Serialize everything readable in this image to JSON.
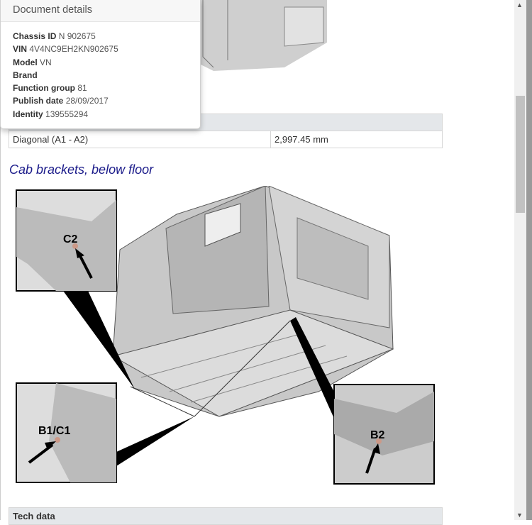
{
  "popup": {
    "title": "Document details",
    "rows": [
      {
        "label": "Chassis ID",
        "value": "N 902675"
      },
      {
        "label": "VIN",
        "value": "4V4NC9EH2KN902675"
      },
      {
        "label": "Model",
        "value": "VN"
      },
      {
        "label": "Brand",
        "value": ""
      },
      {
        "label": "Function group",
        "value": "81"
      },
      {
        "label": "Publish date",
        "value": "28/09/2017"
      },
      {
        "label": "Identity",
        "value": "139555294"
      }
    ]
  },
  "measure_table": {
    "rows": [
      {
        "label": "Diagonal (A1 - A2)",
        "value": "2,997.45 mm"
      }
    ]
  },
  "section_title": "Cab brackets, below floor",
  "figure": {
    "callouts": {
      "c2": "C2",
      "b1c1": "B1/C1",
      "b2": "B2"
    }
  },
  "tech_table": {
    "header": "Tech data"
  },
  "scrollbar": {
    "position_fraction": 0.2
  }
}
